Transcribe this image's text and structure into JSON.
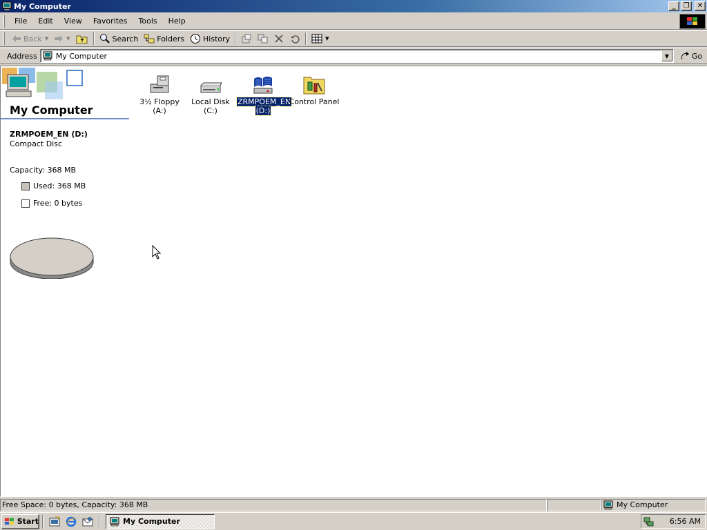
{
  "window": {
    "title": "My Computer"
  },
  "menu": [
    "File",
    "Edit",
    "View",
    "Favorites",
    "Tools",
    "Help"
  ],
  "toolbar": {
    "back": "Back",
    "search": "Search",
    "folders": "Folders",
    "history": "History"
  },
  "address": {
    "label": "Address",
    "value": "My Computer",
    "go": "Go"
  },
  "leftpane": {
    "title": "My Computer",
    "drive_name": "ZRMPOEM_EN (D:)",
    "drive_type": "Compact Disc",
    "capacity": "Capacity: 368 MB",
    "used": "Used: 368 MB",
    "free": "Free: 0 bytes",
    "used_fraction": 1.0
  },
  "items": [
    {
      "label1": "3½ Floppy",
      "label2": "(A:)",
      "icon": "floppy-drive-icon"
    },
    {
      "label1": "Local Disk (C:)",
      "label2": "",
      "icon": "hard-disk-icon"
    },
    {
      "label1": "ZRMPOEM_EN",
      "label2": "(D:)",
      "icon": "cd-drive-icon",
      "selected": true
    },
    {
      "label1": "Control Panel",
      "label2": "",
      "icon": "control-panel-icon"
    }
  ],
  "status": {
    "left": "Free Space: 0 bytes, Capacity: 368 MB",
    "right": "My Computer"
  },
  "taskbar": {
    "start": "Start",
    "task": "My Computer",
    "clock": "6:56 AM"
  }
}
